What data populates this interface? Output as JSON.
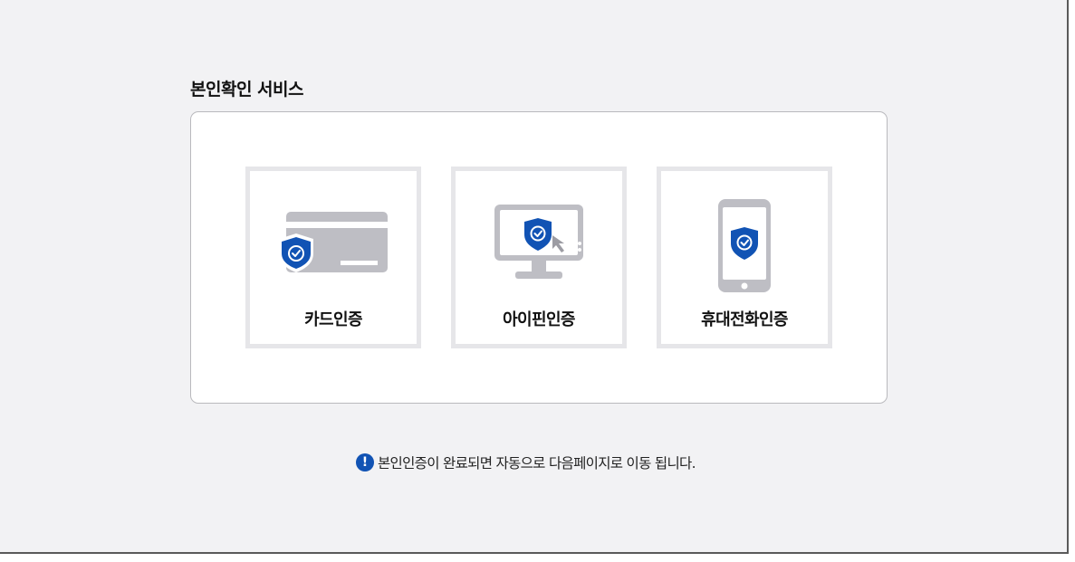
{
  "page": {
    "title": "본인확인 서비스",
    "notice": "본인인증이 완료되면 자동으로 다음페이지로 이동 됩니다.",
    "notice_icon": "exclamation-icon"
  },
  "options": [
    {
      "label": "카드인증",
      "icon": "credit-card-shield-icon"
    },
    {
      "label": "아이핀인증",
      "icon": "monitor-shield-icon"
    },
    {
      "label": "휴대전화인증",
      "icon": "mobile-phone-shield-icon"
    }
  ],
  "colors": {
    "background": "#f2f2f4",
    "accent": "#1153b4",
    "illustration_gray": "#bebec4",
    "card_border": "#e6e6e9"
  }
}
